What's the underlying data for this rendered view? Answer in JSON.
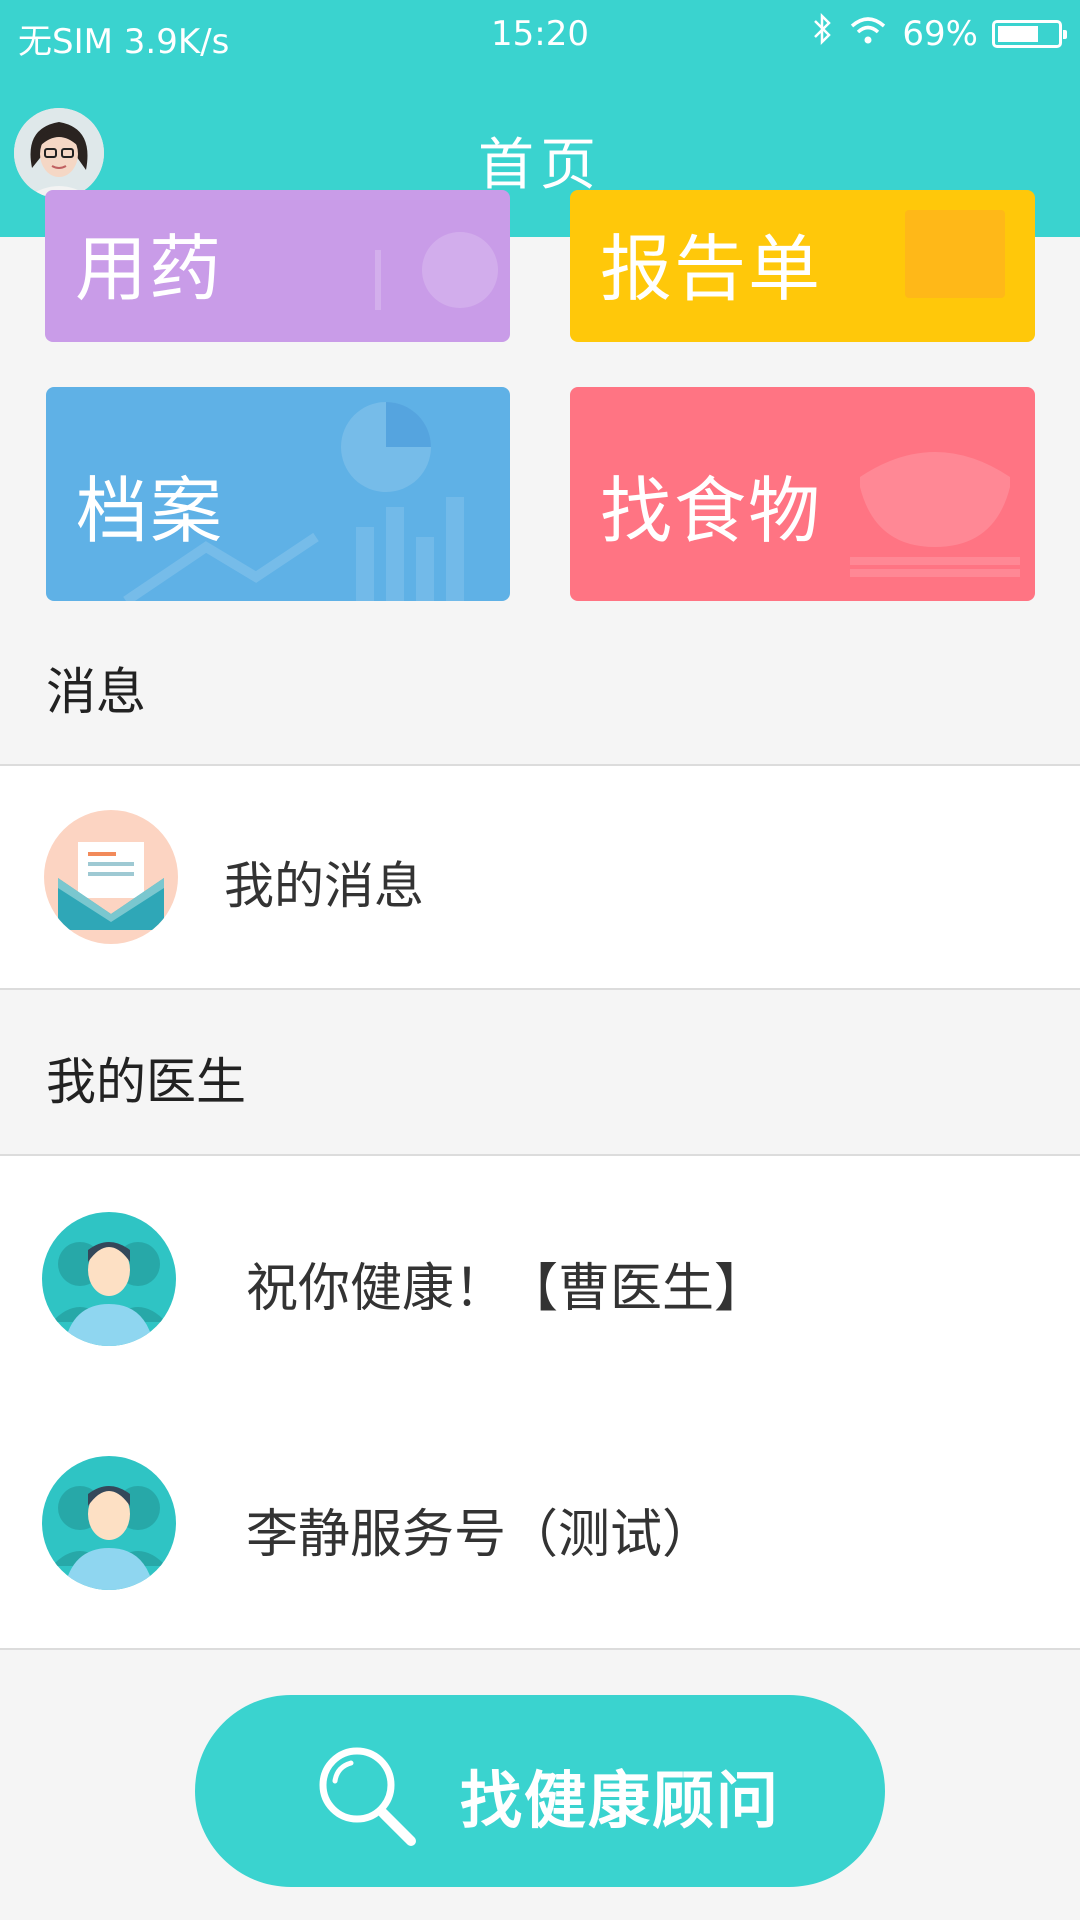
{
  "status_bar": {
    "carrier": "无SIM 3.9K/s",
    "time": "15:20",
    "battery": "69%",
    "battery_level": 0.69
  },
  "header": {
    "title": "首页"
  },
  "tiles": [
    {
      "label": "用药",
      "color": "#c99ce8"
    },
    {
      "label": "报告单",
      "color": "#ffc80a"
    },
    {
      "label": "档案",
      "color": "#5fb1e6"
    },
    {
      "label": "找食物",
      "color": "#ff7483"
    }
  ],
  "messages": {
    "section_title": "消息",
    "items": [
      {
        "label": "我的消息",
        "icon": "envelope-icon"
      }
    ]
  },
  "doctors": {
    "section_title": "我的医生",
    "items": [
      {
        "label": "祝你健康！【曹医生】",
        "icon": "doctor-avatar-icon"
      },
      {
        "label": "李静服务号（测试）",
        "icon": "doctor-avatar-icon"
      }
    ]
  },
  "cta": {
    "label": "找健康顾问",
    "icon": "search-icon"
  },
  "colors": {
    "accent": "#3ad3cf"
  }
}
